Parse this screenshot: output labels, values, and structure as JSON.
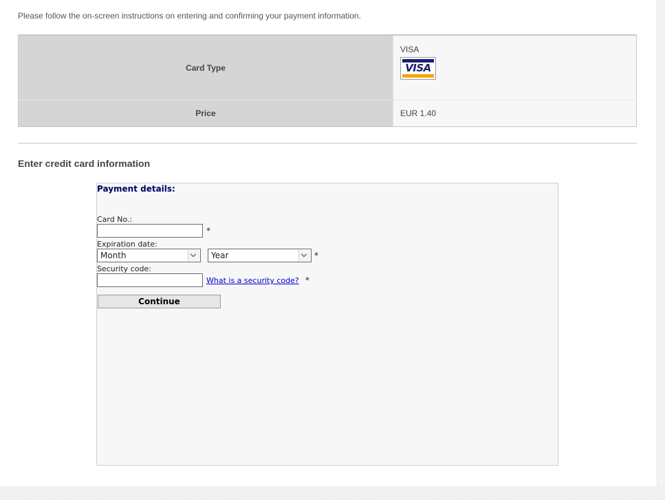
{
  "instructions": "Please follow the on-screen instructions on entering and confirming your payment information.",
  "summary": {
    "card_type_label": "Card Type",
    "card_type_value": "VISA",
    "card_logo_text": "VISA",
    "price_label": "Price",
    "price_value": "EUR 1.40"
  },
  "section_title": "Enter credit card information",
  "form": {
    "title": "Payment details:",
    "card_no_label": "Card No.:",
    "card_no_value": "",
    "expiration_label": "Expiration date:",
    "month_selected": "Month",
    "year_selected": "Year",
    "security_label": "Security code:",
    "security_value": "",
    "security_link": "What is a security code?",
    "required_mark": "*",
    "continue_label": "Continue"
  },
  "colors": {
    "visa_blue": "#1a1f71",
    "visa_gold": "#f7a600",
    "form_title": "#000066",
    "link": "#0000cc"
  }
}
